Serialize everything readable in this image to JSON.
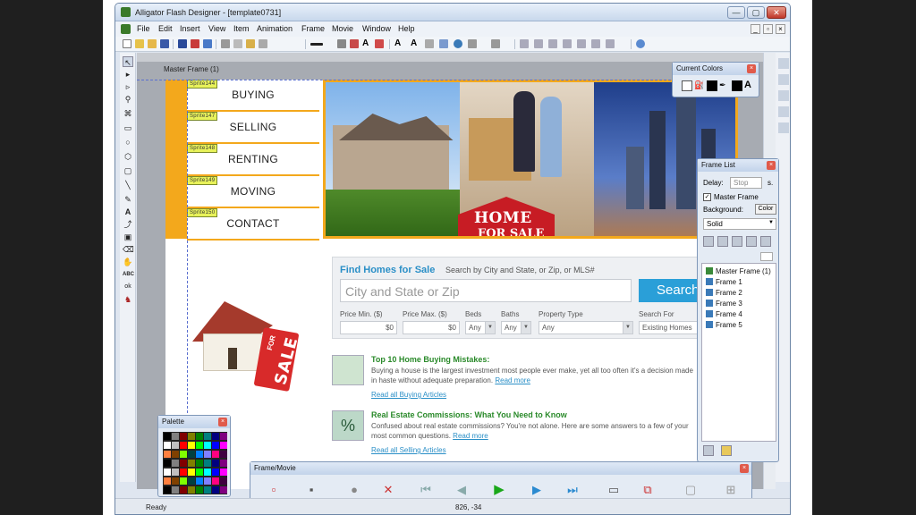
{
  "app": {
    "title": "Alligator Flash Designer - [template0731]",
    "min_label": "—",
    "max_label": "▢",
    "close_label": "✕"
  },
  "menu": {
    "items": [
      "File",
      "Edit",
      "Insert",
      "View",
      "Item",
      "Animation",
      "Frame",
      "Movie",
      "Window",
      "Help"
    ]
  },
  "canvas": {
    "frame_label": "Master Frame (1)"
  },
  "site": {
    "nav": [
      {
        "sprite": "Sprite144",
        "label": "BUYING"
      },
      {
        "sprite": "Sprite147",
        "label": "SELLING"
      },
      {
        "sprite": "Sprite148",
        "label": "RENTING"
      },
      {
        "sprite": "Sprite149",
        "label": "MOVING"
      },
      {
        "sprite": "Sprite150",
        "label": "CONTACT"
      }
    ],
    "hero_sign_line1": "HOME",
    "hero_sign_line2": "FOR SALE",
    "house_tag_for": "FOR",
    "house_tag_sale": "SALE",
    "search": {
      "title": "Find Homes for Sale",
      "subtitle": "Search by City and State, or Zip, or MLS#",
      "placeholder": "City and State or Zip",
      "button": "Search",
      "fields": [
        {
          "label": "Price Min. ($)",
          "value": "$0"
        },
        {
          "label": "Price Max. ($)",
          "value": "$0"
        },
        {
          "label": "Beds",
          "value": "Any"
        },
        {
          "label": "Baths",
          "value": "Any"
        },
        {
          "label": "Property Type",
          "value": "Any"
        },
        {
          "label": "Search For",
          "value": "Existing Homes"
        }
      ]
    },
    "articles": [
      {
        "title": "Top 10 Home Buying Mistakes:",
        "text": "Buying a house is the largest investment most people ever make, yet all too often it's a decision made in haste without adequate preparation.",
        "more": "Read more",
        "all": "Read all Buying Articles"
      },
      {
        "title": "Real Estate Commissions: What You Need to Know",
        "text": "Confused about real estate commissions? You're not alone. Here are some answers to a few of your most common questions.",
        "more": "Read more",
        "all": "Read all Selling Articles"
      }
    ]
  },
  "panels": {
    "current_colors": {
      "title": "Current Colors",
      "text_glyph": "A"
    },
    "frame_list": {
      "title": "Frame List",
      "delay_label": "Delay:",
      "delay_value": "Stop",
      "delay_unit": "s.",
      "master_frame_check": "Master Frame",
      "background_label": "Background:",
      "color_button": "Color",
      "fill_value": "Solid",
      "frames": [
        "Master Frame (1)",
        "Frame 1",
        "Frame 2",
        "Frame 3",
        "Frame 4",
        "Frame 5"
      ]
    },
    "palette": {
      "title": "Palette"
    },
    "frame_movie": {
      "title": "Frame/Movie"
    }
  },
  "status": {
    "text": "Ready",
    "coords": "826, -34"
  }
}
